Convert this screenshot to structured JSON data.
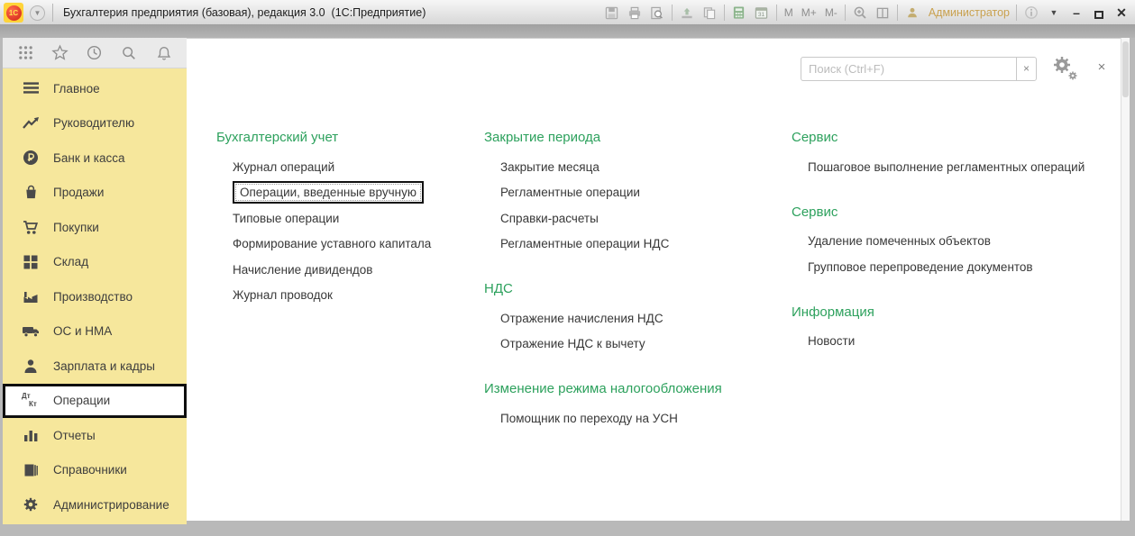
{
  "titlebar": {
    "logo_text": "1С",
    "title": "Бухгалтерия предприятия (базовая), редакция 3.0  (1С:Предприятие)",
    "memory_labels": {
      "m": "M",
      "m_plus": "M+",
      "m_minus": "M-"
    },
    "user_label": "Администратор",
    "icons": [
      "save-icon",
      "print-icon",
      "print-preview-icon",
      "send-icon",
      "copy-icon",
      "calculator-icon",
      "calendar-icon",
      "zoom-icon",
      "split-window-icon",
      "user-icon",
      "info-icon",
      "chevron-down-icon",
      "minimize-icon",
      "maximize-icon",
      "close-icon"
    ]
  },
  "left_toolbar": {
    "icons": [
      "apps-grid-icon",
      "favorites-star-icon",
      "history-clock-icon",
      "search-icon",
      "notifications-bell-icon"
    ]
  },
  "sidebar": {
    "items": [
      {
        "label": "Главное",
        "icon": "menu-icon",
        "selected": false
      },
      {
        "label": "Руководителю",
        "icon": "trend-icon",
        "selected": false
      },
      {
        "label": "Банк и касса",
        "icon": "ruble-icon",
        "selected": false
      },
      {
        "label": "Продажи",
        "icon": "bag-icon",
        "selected": false
      },
      {
        "label": "Покупки",
        "icon": "cart-icon",
        "selected": false
      },
      {
        "label": "Склад",
        "icon": "warehouse-icon",
        "selected": false
      },
      {
        "label": "Производство",
        "icon": "factory-icon",
        "selected": false
      },
      {
        "label": "ОС и НМА",
        "icon": "truck-icon",
        "selected": false
      },
      {
        "label": "Зарплата и кадры",
        "icon": "person-icon",
        "selected": false
      },
      {
        "label": "Операции",
        "icon": "dtkt-icon",
        "icon_text_top": "Дт",
        "icon_text_bottom": "Кт",
        "selected": true
      },
      {
        "label": "Отчеты",
        "icon": "chart-icon",
        "selected": false
      },
      {
        "label": "Справочники",
        "icon": "books-icon",
        "selected": false
      },
      {
        "label": "Администрирование",
        "icon": "gear-icon",
        "selected": false
      }
    ]
  },
  "search": {
    "placeholder": "Поиск (Ctrl+F)",
    "clear_label": "×",
    "close_label": "×"
  },
  "content": {
    "columns": [
      {
        "sections": [
          {
            "title": "Бухгалтерский учет",
            "items": [
              {
                "label": "Журнал операций",
                "selected": false
              },
              {
                "label": "Операции, введенные вручную",
                "selected": true
              },
              {
                "label": "Типовые операции",
                "selected": false
              },
              {
                "label": "Формирование уставного капитала",
                "selected": false
              },
              {
                "label": "Начисление дивидендов",
                "selected": false
              },
              {
                "label": "Журнал проводок",
                "selected": false
              }
            ]
          }
        ]
      },
      {
        "sections": [
          {
            "title": "Закрытие периода",
            "items": [
              {
                "label": "Закрытие месяца",
                "selected": false
              },
              {
                "label": "Регламентные операции",
                "selected": false
              },
              {
                "label": "Справки-расчеты",
                "selected": false
              },
              {
                "label": "Регламентные операции НДС",
                "selected": false
              }
            ]
          },
          {
            "title": "НДС",
            "items": [
              {
                "label": "Отражение начисления НДС",
                "selected": false
              },
              {
                "label": "Отражение НДС к вычету",
                "selected": false
              }
            ]
          },
          {
            "title": "Изменение режима налогообложения",
            "items": [
              {
                "label": "Помощник по переходу на УСН",
                "selected": false
              }
            ]
          }
        ]
      },
      {
        "sections": [
          {
            "title": "Сервис",
            "items": [
              {
                "label": "Пошаговое выполнение регламентных операций",
                "selected": false
              }
            ]
          },
          {
            "title": "Сервис",
            "items": [
              {
                "label": "Удаление помеченных объектов",
                "selected": false
              },
              {
                "label": "Групповое перепроведение документов",
                "selected": false
              }
            ]
          },
          {
            "title": "Информация",
            "items": [
              {
                "label": "Новости",
                "selected": false
              }
            ]
          }
        ]
      }
    ]
  },
  "colors": {
    "accent_green": "#2da15d",
    "sidebar_yellow": "#f6e79c",
    "user_text": "#c9a14f",
    "selection_border": "#0f0f0f"
  }
}
